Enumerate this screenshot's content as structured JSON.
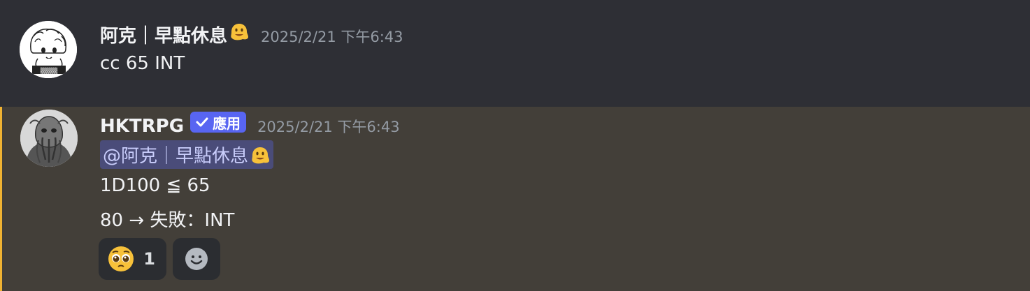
{
  "messages": [
    {
      "username": "阿克｜早點休息",
      "username_emoji": "melting-face-emoji",
      "timestamp": "2025/2/21 下午6:43",
      "content": "cc 65 INT"
    },
    {
      "username": "HKTRPG",
      "badge": "應用",
      "timestamp": "2025/2/21 下午6:43",
      "mention": "@阿克｜早點休息",
      "mention_emoji": "melting-face-emoji",
      "lines": [
        "1D100 ≦ 65",
        "80 → 失敗：INT"
      ],
      "reactions": [
        {
          "emoji": "pleading-face-emoji",
          "count": "1"
        },
        {
          "emoji": "add-reaction-icon"
        }
      ]
    }
  ],
  "colors": {
    "background": "#313338",
    "highlight_bg": "#433f39",
    "highlight_border": "#f0b232",
    "badge": "#5865f2",
    "mention_text": "#c9cdfb",
    "timestamp": "#949ba4"
  }
}
